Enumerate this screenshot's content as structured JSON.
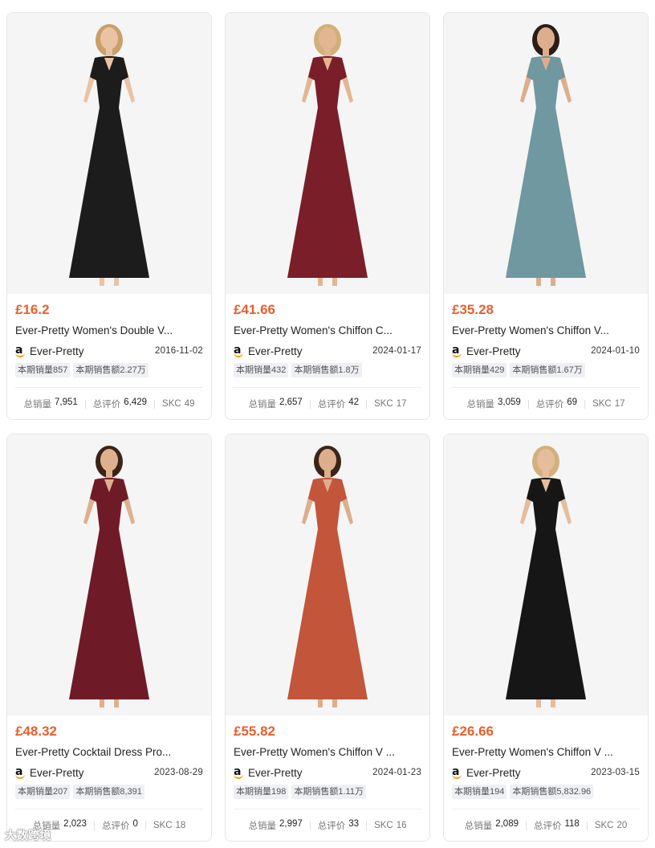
{
  "products": [
    {
      "price": "£16.2",
      "title": "Ever-Pretty Women's Double V...",
      "seller": "Ever-Pretty",
      "date": "2016-11-02",
      "tag_sales": "本期销量857",
      "tag_revenue": "本期销售额2.27万",
      "total_sales_label": "总销量",
      "total_sales": "7,951",
      "reviews_label": "总评价",
      "reviews": "6,429",
      "skc_label": "SKC",
      "skc": "49",
      "dress_color": "#1c1c1c",
      "skin": "#e9c3a4",
      "hair": "#c9a06a"
    },
    {
      "price": "£41.66",
      "title": "Ever-Pretty Women's Chiffon C...",
      "seller": "Ever-Pretty",
      "date": "2024-01-17",
      "tag_sales": "本期销量432",
      "tag_revenue": "本期销售额1.8万",
      "total_sales_label": "总销量",
      "total_sales": "2,657",
      "reviews_label": "总评价",
      "reviews": "42",
      "skc_label": "SKC",
      "skc": "17",
      "dress_color": "#7a1e2a",
      "skin": "#e3b692",
      "hair": "#d1b07a"
    },
    {
      "price": "£35.28",
      "title": "Ever-Pretty Women's Chiffon V...",
      "seller": "Ever-Pretty",
      "date": "2024-01-10",
      "tag_sales": "本期销量429",
      "tag_revenue": "本期销售额1.67万",
      "total_sales_label": "总销量",
      "total_sales": "3,059",
      "reviews_label": "总评价",
      "reviews": "69",
      "skc_label": "SKC",
      "skc": "17",
      "dress_color": "#6f98a0",
      "skin": "#dcae8c",
      "hair": "#2a1c16"
    },
    {
      "price": "£48.32",
      "title": "Ever-Pretty Cocktail Dress Pro...",
      "seller": "Ever-Pretty",
      "date": "2023-08-29",
      "tag_sales": "本期销量207",
      "tag_revenue": "本期销售额8,391",
      "total_sales_label": "总销量",
      "total_sales": "2,023",
      "reviews_label": "总评价",
      "reviews": "0",
      "skc_label": "SKC",
      "skc": "18",
      "dress_color": "#6e1b27",
      "skin": "#deb08e",
      "hair": "#3a2418"
    },
    {
      "price": "£55.82",
      "title": "Ever-Pretty Women's Chiffon V ...",
      "seller": "Ever-Pretty",
      "date": "2024-01-23",
      "tag_sales": "本期销量198",
      "tag_revenue": "本期销售额1.11万",
      "total_sales_label": "总销量",
      "total_sales": "2,997",
      "reviews_label": "总评价",
      "reviews": "33",
      "skc_label": "SKC",
      "skc": "16",
      "dress_color": "#c2553a",
      "skin": "#dcae8c",
      "hair": "#3b2519"
    },
    {
      "price": "£26.66",
      "title": "Ever-Pretty Women's Chiffon V ...",
      "seller": "Ever-Pretty",
      "date": "2023-03-15",
      "tag_sales": "本期销量194",
      "tag_revenue": "本期销售额5,832.96",
      "total_sales_label": "总销量",
      "total_sales": "2,089",
      "reviews_label": "总评价",
      "reviews": "118",
      "skc_label": "SKC",
      "skc": "20",
      "dress_color": "#161616",
      "skin": "#e6bd9c",
      "hair": "#d2b07c"
    }
  ],
  "watermark": "大数跨境"
}
